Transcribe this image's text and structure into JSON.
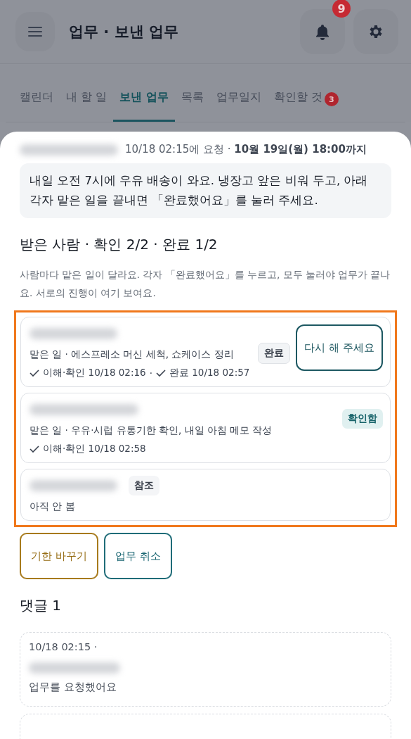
{
  "header": {
    "title": "업무 · 보낸 업무",
    "notifications": "9"
  },
  "tabs": [
    {
      "label": "캘린더",
      "selected": false
    },
    {
      "label": "내 할 일",
      "selected": false
    },
    {
      "label": "보낸 업무",
      "selected": true
    },
    {
      "label": "목록",
      "selected": false
    },
    {
      "label": "업무일지",
      "selected": false
    },
    {
      "label": "확인할 것",
      "selected": false,
      "badge": "3"
    }
  ],
  "task": {
    "requester_hidden": true,
    "requested": "10/18 02:15에 요청 · ",
    "deadline": "10월 19일(월) 18:00까지",
    "instruction": "내일 오전 7시에 우유 배송이 와요. 냉장고 앞은 비워 두고, 아래 각자 맡은 일을 끝내면 「완료했어요」를 눌러 주세요."
  },
  "recipients": {
    "heading": "받은 사람 · 확인 2/2 · 완료 1/2",
    "description": "사람마다 맡은 일이 달라요. 각자 「완료했어요」를 누르고, 모두 눌러야 업무가 끝나요. 서로의 진행이 여기 보여요.",
    "highlighted": true,
    "items": [
      {
        "name_hidden": true,
        "status": {
          "kind": "done",
          "label": "완료"
        },
        "assignment": "맡은 일 · 에스프레소 머신 세척, 쇼케이스 정리",
        "progress": [
          {
            "label": "이해·확인 10/18 02:16"
          },
          {
            "separator": "·",
            "label": "완료 10/18 02:57"
          }
        ],
        "action": "다시 해 주세요"
      },
      {
        "name_hidden": true,
        "status": {
          "kind": "acknowledged",
          "label": "확인함"
        },
        "assignment": "맡은 일 · 우유·시럽 유통기한 확인, 내일 아침 메모 작성",
        "progress": [
          {
            "label": "이해·확인 10/18 02:58"
          }
        ]
      },
      {
        "name_hidden": true,
        "status": {
          "kind": "cc",
          "label": "참조"
        },
        "note": "아직 안 봄"
      }
    ]
  },
  "actions": [
    {
      "label": "기한 바꾸기",
      "kind": "warning"
    },
    {
      "label": "업무 취소",
      "kind": "primary"
    }
  ],
  "comments": {
    "heading": "댓글 1",
    "items": [
      {
        "time": "10/18 02:15 ·",
        "author_hidden": true,
        "text": "업무를 요청했어요"
      }
    ],
    "more_below": true
  }
}
